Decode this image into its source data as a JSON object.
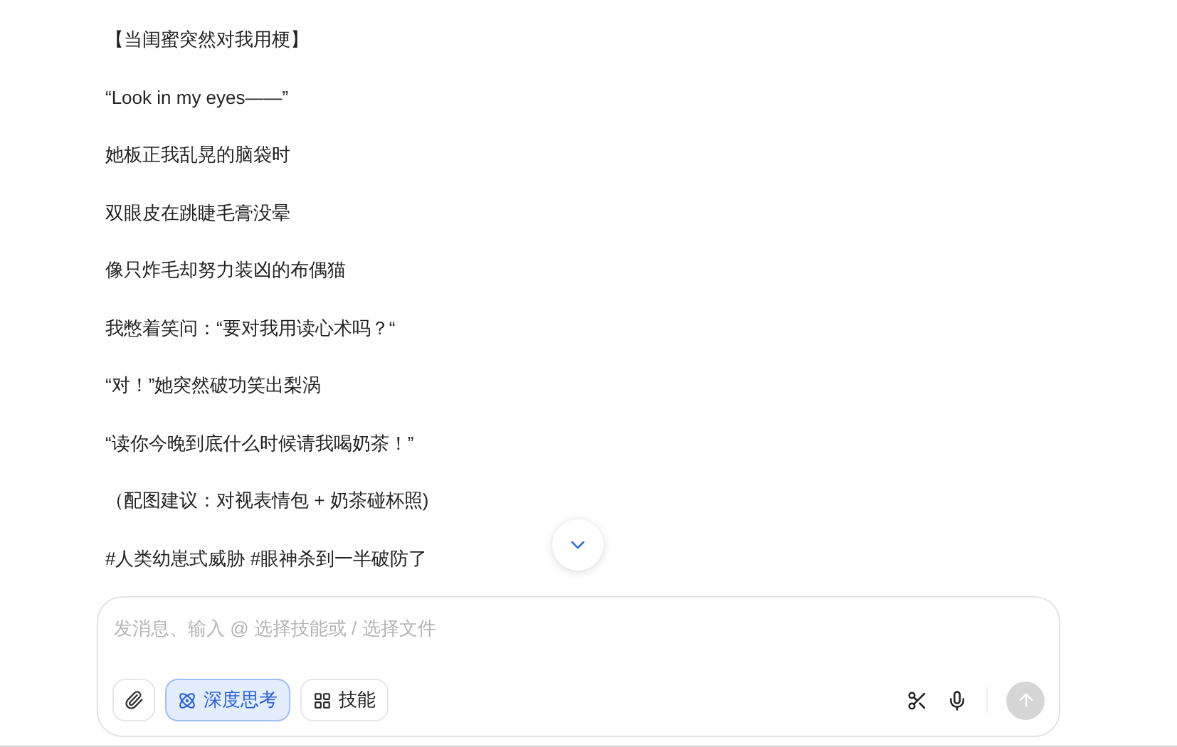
{
  "message": {
    "lines": [
      "【当闺蜜突然对我用梗】",
      "“Look in my eyes——”",
      "她板正我乱晃的脑袋时",
      "双眼皮在跳睫毛膏没晕",
      "像只炸毛却努力装凶的布偶猫",
      "我憋着笑问：“要对我用读心术吗？“",
      "“对！”她突然破功笑出梨涡",
      "“读你今晚到底什么时候请我喝奶茶！”",
      "（配图建议：对视表情包 + 奶茶碰杯照)",
      "#人类幼崽式威胁 #眼神杀到一半破防了"
    ]
  },
  "composer": {
    "placeholder": "发消息、输入 @ 选择技能或 / 选择文件",
    "tools": [
      {
        "kind": "attach"
      },
      {
        "kind": "deep-think",
        "label": "深度思考",
        "selected": true
      },
      {
        "kind": "skills",
        "label": "技能",
        "selected": false
      }
    ],
    "send_disabled": true
  }
}
